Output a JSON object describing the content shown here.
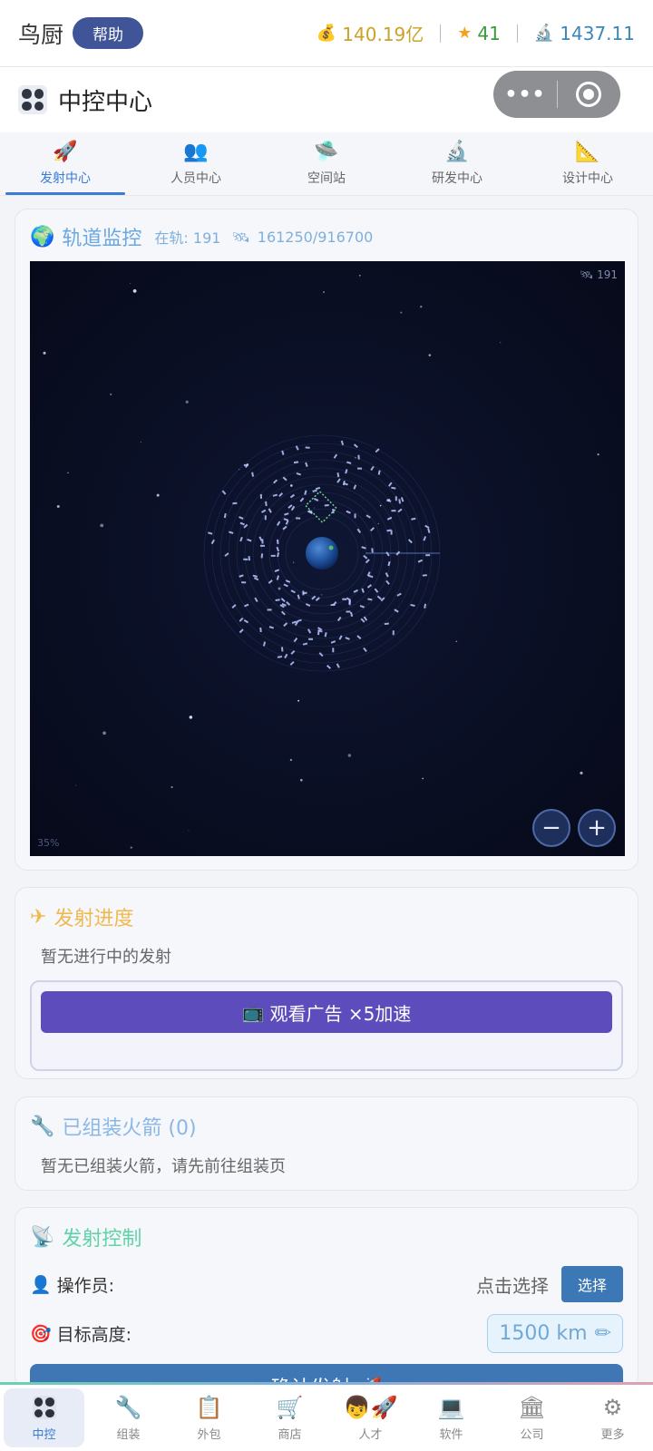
{
  "topbar": {
    "app_name": "鸟厨",
    "help_label": "帮助",
    "money": "140.19亿",
    "stars": "41",
    "research": "1437.11"
  },
  "header": {
    "title": "中控中心"
  },
  "tabs": [
    {
      "label": "发射中心",
      "icon": "rocket-icon",
      "glyph": "🚀",
      "active": true
    },
    {
      "label": "人员中心",
      "icon": "people-icon",
      "glyph": "👥",
      "active": false
    },
    {
      "label": "空间站",
      "icon": "ufo-icon",
      "glyph": "🛸",
      "active": false
    },
    {
      "label": "研发中心",
      "icon": "microscope-icon",
      "glyph": "🔬",
      "active": false
    },
    {
      "label": "设计中心",
      "icon": "ruler-icon",
      "glyph": "📐",
      "active": false
    }
  ],
  "orbit": {
    "title": "轨道监控",
    "on_orbit_label": "在轨: 191",
    "capacity": "161250/916700",
    "sat_count": "191",
    "zoom": "35%",
    "zoom_out": "−",
    "zoom_in": "+"
  },
  "progress": {
    "title": "发射进度",
    "empty_text": "暂无进行中的发射",
    "ad_button": "观看广告 ×5加速"
  },
  "rockets": {
    "title": "已组装火箭 (0)",
    "empty_text": "暂无已组装火箭，请先前往组装页"
  },
  "control": {
    "title": "发射控制",
    "operator_label": "操作员:",
    "operator_hint": "点击选择",
    "select_button": "选择",
    "altitude_label": "目标高度:",
    "altitude_value": "1500 km",
    "launch_button": "确认发射 🚀"
  },
  "bottom_nav": [
    {
      "label": "中控",
      "icon": "grid-icon",
      "glyph": "",
      "active": true
    },
    {
      "label": "组装",
      "icon": "wrench-icon",
      "glyph": "🔧",
      "active": false
    },
    {
      "label": "外包",
      "icon": "clipboard-icon",
      "glyph": "📋",
      "active": false
    },
    {
      "label": "商店",
      "icon": "cart-icon",
      "glyph": "🛒",
      "active": false
    },
    {
      "label": "人才",
      "icon": "talent-icon",
      "glyph": "👦🚀",
      "active": false
    },
    {
      "label": "软件",
      "icon": "laptop-icon",
      "glyph": "💻",
      "active": false
    },
    {
      "label": "公司",
      "icon": "building-icon",
      "glyph": "🏛",
      "active": false
    },
    {
      "label": "更多",
      "icon": "gear-icon",
      "glyph": "⚙",
      "active": false
    }
  ],
  "colors": {
    "accent": "#3a7bd5",
    "ad_button": "#5d4cbb",
    "launch_button": "#3f77b4",
    "help_button": "#3f5597"
  }
}
